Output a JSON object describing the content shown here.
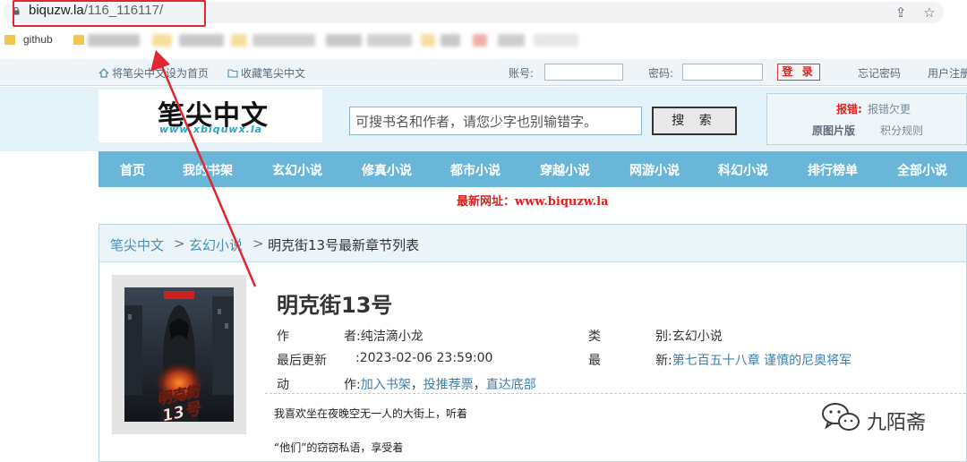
{
  "browser": {
    "url_host": "biquzw.la",
    "url_path": "/116_116117/",
    "bookmark": "github"
  },
  "topbar": {
    "set_home": "将笔尖中文设为首页",
    "bookmark_site": "收藏笔尖中文",
    "account_label": "账号:",
    "password_label": "密码:",
    "login_button": "登 录",
    "forgot_password": "忘记密码",
    "register": "用户注册"
  },
  "header": {
    "logo_text": "笔尖中文",
    "logo_url": "www.xbiquwx.la",
    "search_placeholder": "可搜书名和作者，请您少字也别输错字。",
    "search_button": "搜 索",
    "report_label": "报错:",
    "report_link": "报错欠更",
    "original_pic": "原图片版",
    "points_rules": "积分规则"
  },
  "nav": {
    "items": [
      "首页",
      "我的书架",
      "玄幻小说",
      "修真小说",
      "都市小说",
      "穿越小说",
      "网游小说",
      "科幻小说",
      "排行榜单",
      "全部小说"
    ]
  },
  "notice": {
    "label": "最新网址：",
    "url": "www.biquzw.la"
  },
  "breadcrumb": {
    "home": "笔尖中文",
    "category": "玄幻小说",
    "current": "明克街13号最新章节列表",
    "separator": ">"
  },
  "book": {
    "cover_title": "明克街13号",
    "title": "明克街13号",
    "author_label_a": "作",
    "author_label_b": "者:",
    "author": "纯洁滴小龙",
    "category_label_a": "类",
    "category_label_b": "别:",
    "category": "玄幻小说",
    "updated_label": "最后更新",
    "updated_value": ":2023-02-06 23:59:00",
    "latest_label_a": "最",
    "latest_label_b": "新:",
    "latest_chapter": "第七百五十八章 谨慎的尼奥将军",
    "action_label_a": "动",
    "action_label_b": "作:",
    "actions": [
      "加入书架",
      "投推荐票",
      "直达底部"
    ],
    "action_separator": "，",
    "intro_lines": [
      "我喜欢坐在夜晚空无一人的大街上，听着",
      "“他们”的窃窃私语，享受着"
    ]
  },
  "watermark": {
    "text": "九陌斋"
  },
  "colors": {
    "annotation_red": "#e0262f",
    "nav_blue": "#6ab6d8",
    "link_blue": "#3a7fb0",
    "notice_red": "#e11f1f"
  }
}
